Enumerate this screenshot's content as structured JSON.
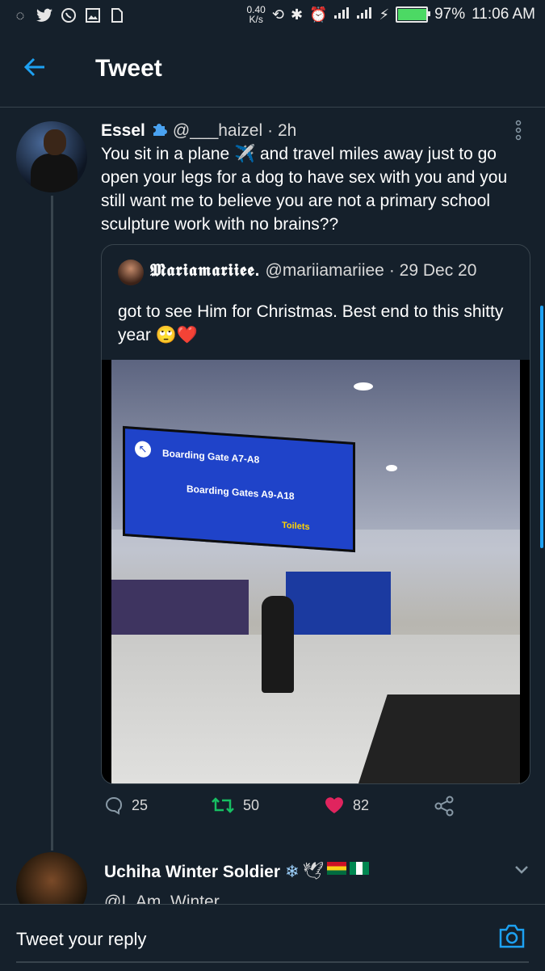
{
  "statusbar": {
    "netspeed_value": "0.40",
    "netspeed_unit": "K/s",
    "battery": "97%",
    "battery_level": 0.97,
    "time": "11:06 AM",
    "icons": [
      "loading-icon",
      "twitter-icon",
      "whatsapp-icon",
      "gallery-icon",
      "sim-icon",
      "rotate-icon",
      "bluetooth-icon",
      "alarm-icon",
      "signal-icon",
      "data-icon",
      "charging-icon"
    ]
  },
  "header": {
    "title": "Tweet",
    "back_icon": "arrow-left-icon"
  },
  "tweet": {
    "name": "Essel",
    "badge_icon": "puzzle-icon",
    "handle": "@___haizel",
    "time": "· 2h",
    "text": "You sit in a plane ✈️ and travel miles away just to go open your legs for a dog to have sex with you and you still want me to believe you are not a primary school sculpture work with no brains??",
    "quote": {
      "name": "𝕸𝖆𝖗𝖎𝖆𝖒𝖆𝖗𝖎𝖎𝖊𝖊.",
      "handle": "@mariiamariiee",
      "time": "· 29 Dec 20",
      "text": "got to see Him for Christmas. Best end to this shitty year 🙄❤️",
      "video": {
        "sign_line1": "Boarding Gate A7-A8",
        "sign_line2": "Boarding Gates A9-A18",
        "sign_line3": "Toilets"
      }
    },
    "actions": {
      "replies": "25",
      "retweets": "50",
      "likes": "82"
    }
  },
  "reply_tweet": {
    "name": "Uchiha Winter Soldier",
    "handle": "@I_Am_Winter"
  },
  "reply_bar": {
    "placeholder": "Tweet your reply"
  },
  "colors": {
    "accent": "#1da1f2",
    "background": "#15202b",
    "retweet": "#17bf63",
    "like": "#e0245e",
    "divider": "#38444d"
  }
}
